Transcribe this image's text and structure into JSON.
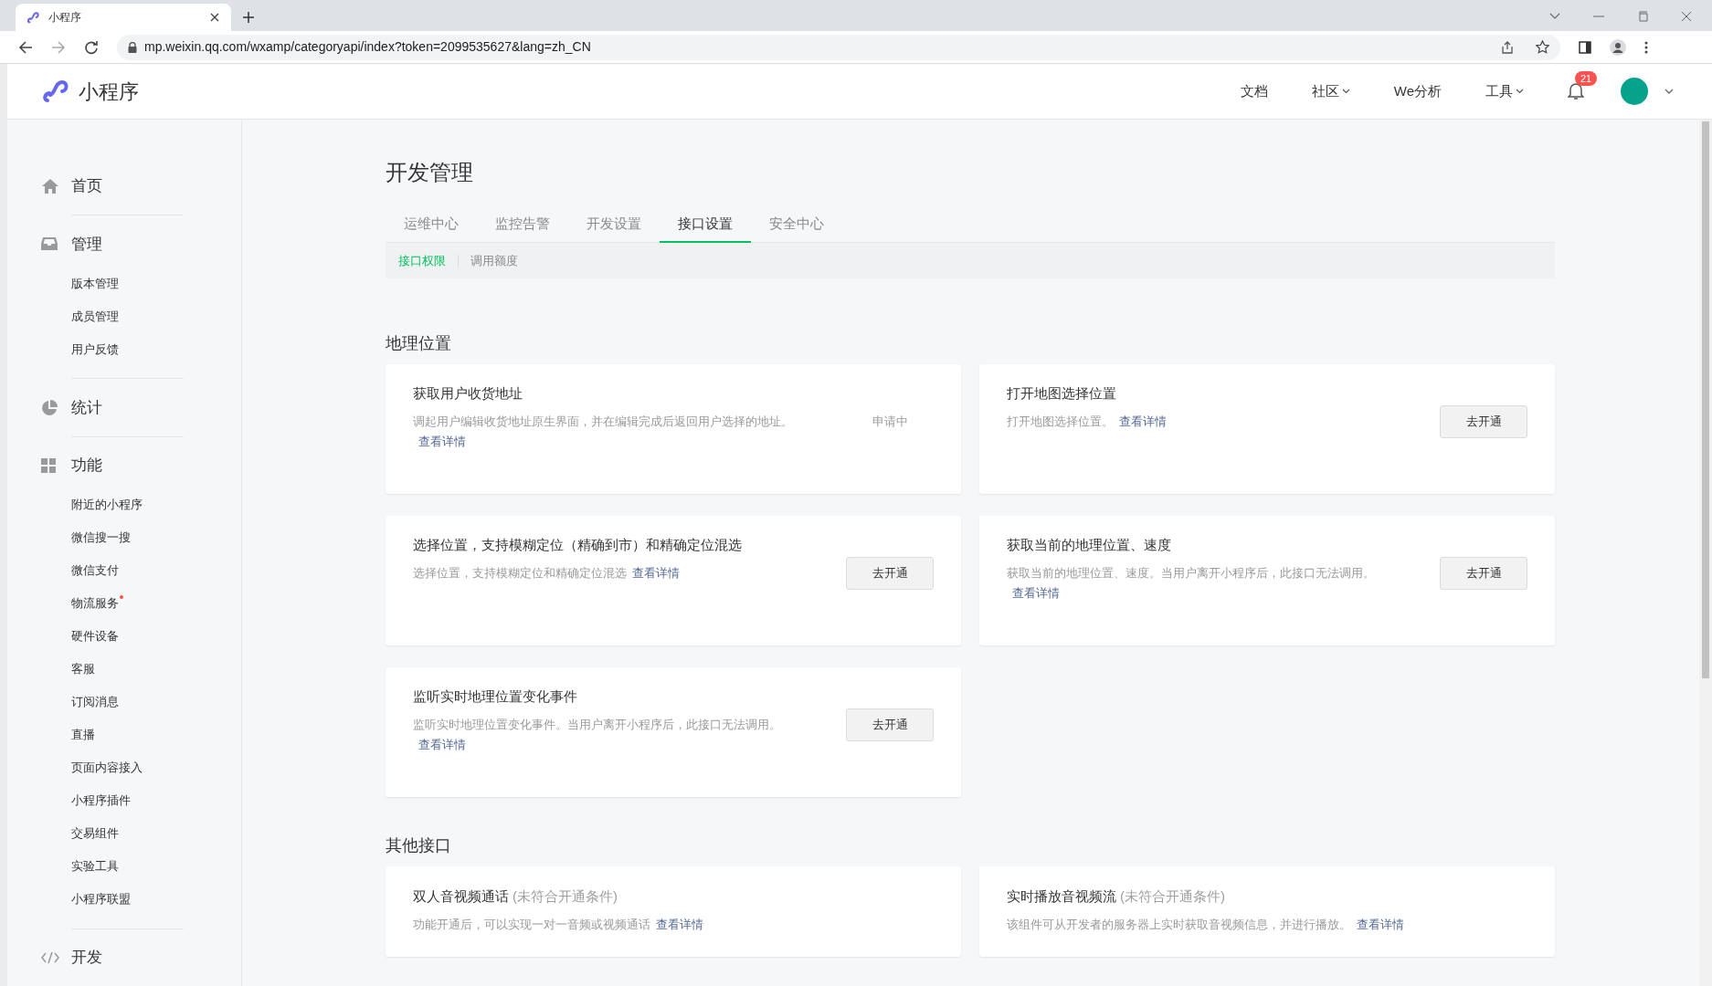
{
  "browser": {
    "tab_title": "小程序",
    "url": "mp.weixin.qq.com/wxamp/categoryapi/index?token=2099535627&lang=zh_CN"
  },
  "header": {
    "logo_text": "小程序",
    "nav": [
      {
        "label": "文档",
        "dropdown": false
      },
      {
        "label": "社区",
        "dropdown": true
      },
      {
        "label": "We分析",
        "dropdown": false
      },
      {
        "label": "工具",
        "dropdown": true
      }
    ],
    "notification_count": "21"
  },
  "sidebar": [
    {
      "label": "首页"
    },
    {
      "label": "管理",
      "items": [
        {
          "label": "版本管理",
          "dot": false
        },
        {
          "label": "成员管理",
          "dot": false
        },
        {
          "label": "用户反馈",
          "dot": false
        }
      ]
    },
    {
      "label": "统计"
    },
    {
      "label": "功能",
      "items": [
        {
          "label": "附近的小程序",
          "dot": false
        },
        {
          "label": "微信搜一搜",
          "dot": false
        },
        {
          "label": "微信支付",
          "dot": false
        },
        {
          "label": "物流服务",
          "dot": true
        },
        {
          "label": "硬件设备",
          "dot": false
        },
        {
          "label": "客服",
          "dot": false
        },
        {
          "label": "订阅消息",
          "dot": false
        },
        {
          "label": "直播",
          "dot": false
        },
        {
          "label": "页面内容接入",
          "dot": false
        },
        {
          "label": "小程序插件",
          "dot": false
        },
        {
          "label": "交易组件",
          "dot": false
        },
        {
          "label": "实验工具",
          "dot": false
        },
        {
          "label": "小程序联盟",
          "dot": false
        }
      ]
    },
    {
      "label": "开发"
    }
  ],
  "page_title": "开发管理",
  "tabs": [
    {
      "label": "运维中心",
      "selected": false
    },
    {
      "label": "监控告警",
      "selected": false
    },
    {
      "label": "开发设置",
      "selected": false
    },
    {
      "label": "接口设置",
      "selected": true
    },
    {
      "label": "安全中心",
      "selected": false
    }
  ],
  "subtabs": [
    {
      "label": "接口权限",
      "selected": true
    },
    {
      "label": "调用额度",
      "selected": false
    }
  ],
  "sections": [
    {
      "title": "地理位置",
      "cards": [
        {
          "title": "获取用户收货地址",
          "description": "调起用户编辑收货地址原生界面，并在编辑完成后返回用户选择的地址。",
          "link": "查看详情",
          "action": {
            "kind": "status",
            "label": "申请中"
          }
        },
        {
          "title": "打开地图选择位置",
          "description": "打开地图选择位置。",
          "link": "查看详情",
          "action": {
            "kind": "button",
            "label": "去开通"
          }
        },
        {
          "title": "选择位置，支持模糊定位（精确到市）和精确定位混选",
          "description": "选择位置，支持模糊定位和精确定位混选",
          "link": "查看详情",
          "action": {
            "kind": "button",
            "label": "去开通"
          }
        },
        {
          "title": "获取当前的地理位置、速度",
          "description": "获取当前的地理位置、速度。当用户离开小程序后，此接口无法调用。",
          "link": "查看详情",
          "action": {
            "kind": "button",
            "label": "去开通"
          }
        },
        {
          "title": "监听实时地理位置变化事件",
          "description": "监听实时地理位置变化事件。当用户离开小程序后，此接口无法调用。",
          "link": "查看详情",
          "action": {
            "kind": "button",
            "label": "去开通"
          }
        }
      ]
    },
    {
      "title": "其他接口",
      "cards": [
        {
          "title": "双人音视频通话",
          "note": "(未符合开通条件)",
          "description": "功能开通后，可以实现一对一音频或视频通话",
          "link": "查看详情"
        },
        {
          "title": "实时播放音视频流",
          "note": "(未符合开通条件)",
          "description": "该组件可从开发者的服务器上实时获取音视频信息，并进行播放。",
          "link": "查看详情"
        }
      ]
    }
  ]
}
